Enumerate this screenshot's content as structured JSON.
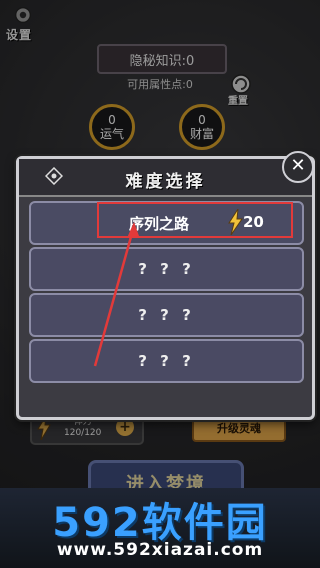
{
  "background": {
    "settings_label": "设置",
    "secret_knowledge": "隐秘知识:0",
    "attribute_points": "可用属性点:0",
    "reset_label": "重置",
    "stats": [
      {
        "value": "0",
        "name": "运气"
      },
      {
        "value": "0",
        "name": "财富"
      }
    ],
    "stamina": {
      "label": "体力",
      "value": "120/120"
    },
    "upgrade_label": "升级灵魂",
    "enter_label": "进入梦境"
  },
  "dialog": {
    "title": "难度选择",
    "options": [
      {
        "label": "序列之路",
        "cost": "20"
      },
      {
        "label": "? ? ?"
      },
      {
        "label": "? ? ?"
      },
      {
        "label": "? ? ?"
      }
    ]
  },
  "watermark": {
    "brand": "592软件园",
    "url": "www.592xiazai.com"
  },
  "colors": {
    "highlight": "#e23a3a",
    "gold": "#d9a22a",
    "watermark_blue": "#3aa0ff"
  }
}
